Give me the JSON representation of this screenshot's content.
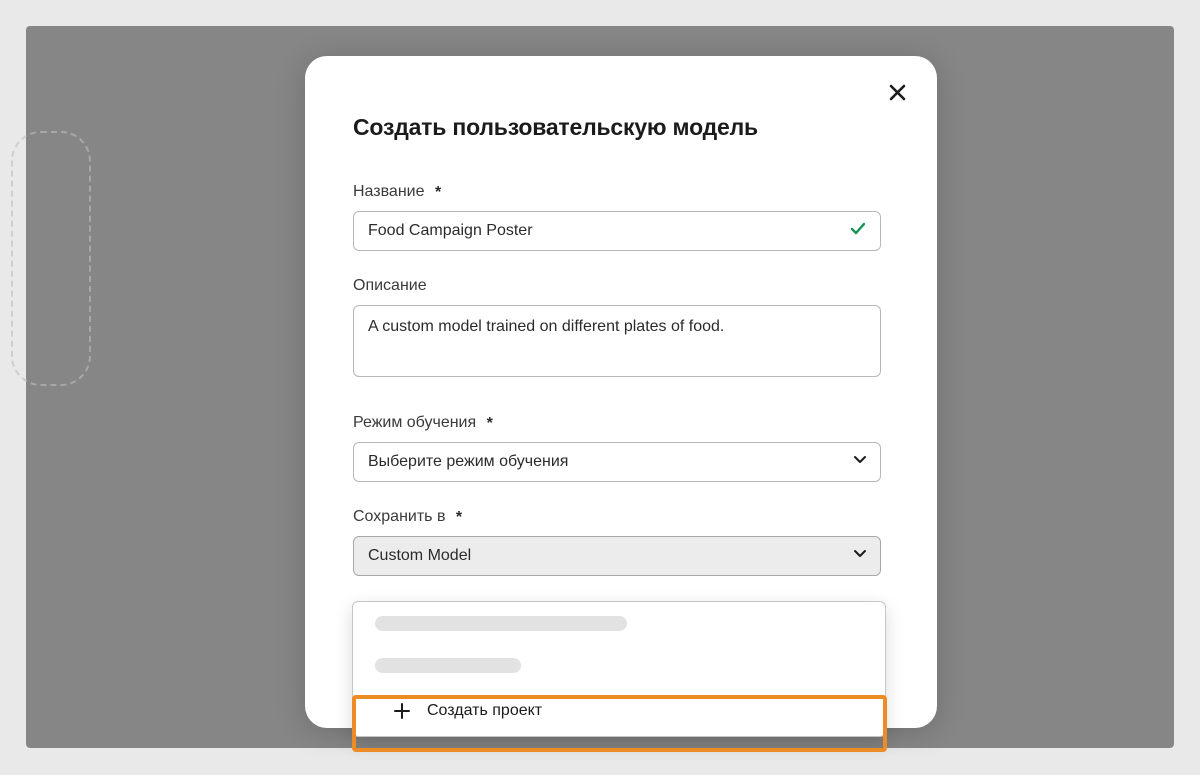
{
  "modal": {
    "title": "Создать пользовательскую модель",
    "fields": {
      "name": {
        "label": "Название",
        "required_mark": "*",
        "value": "Food Campaign Poster"
      },
      "description": {
        "label": "Описание",
        "value": "A custom model trained on different plates of food."
      },
      "training_mode": {
        "label": "Режим обучения",
        "required_mark": "*",
        "placeholder": "Выберите режим обучения"
      },
      "save_to": {
        "label": "Сохранить в",
        "required_mark": "*",
        "value": "Custom Model"
      }
    },
    "dropdown": {
      "create_project_label": "Создать проект"
    }
  }
}
